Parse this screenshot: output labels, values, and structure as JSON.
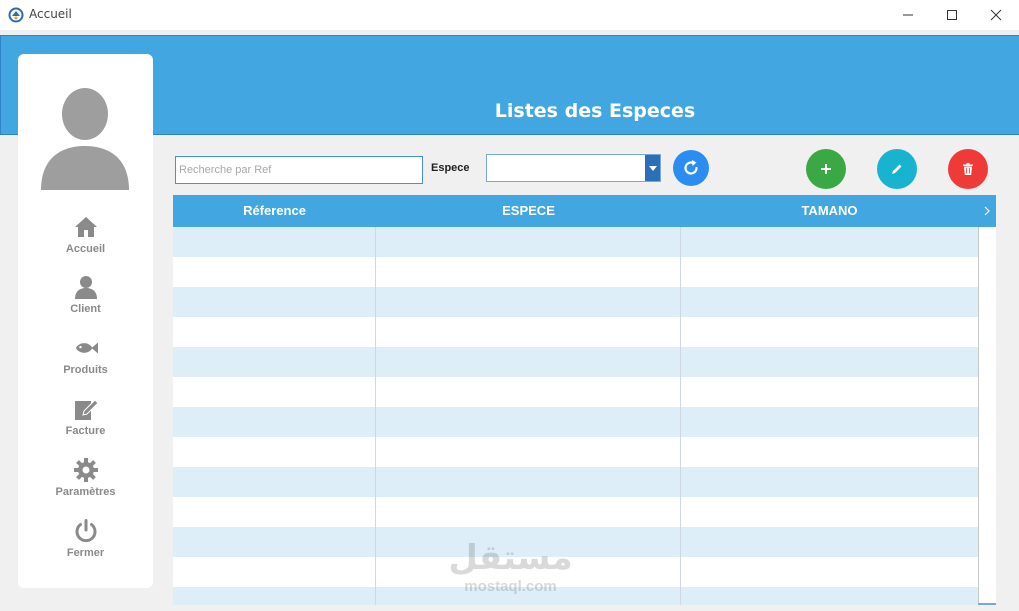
{
  "window": {
    "title": "Accueil"
  },
  "header": {
    "title": "Listes des Especes"
  },
  "sidebar": {
    "items": [
      {
        "label": "Accueil",
        "icon": "home-icon"
      },
      {
        "label": "Client",
        "icon": "user-icon"
      },
      {
        "label": "Produits",
        "icon": "fish-icon"
      },
      {
        "label": "Facture",
        "icon": "invoice-edit-icon"
      },
      {
        "label": "Paramètres",
        "icon": "gear-icon"
      },
      {
        "label": "Fermer",
        "icon": "power-icon"
      }
    ]
  },
  "toolbar": {
    "search_placeholder": "Recherche par Ref",
    "search_value": "",
    "especie_label": "Espece",
    "especie_selected": ""
  },
  "table": {
    "columns": [
      "Réference",
      "ESPECE",
      "TAMANO"
    ],
    "rows": []
  },
  "watermark": {
    "arabic": "مستقل",
    "latin": "mostaql.com"
  },
  "colors": {
    "accent": "#42a6e0",
    "row_alt": "#ddeef8",
    "add": "#3aa845",
    "edit": "#17b3cf",
    "delete": "#ee3b38",
    "refresh": "#2c8df0"
  }
}
